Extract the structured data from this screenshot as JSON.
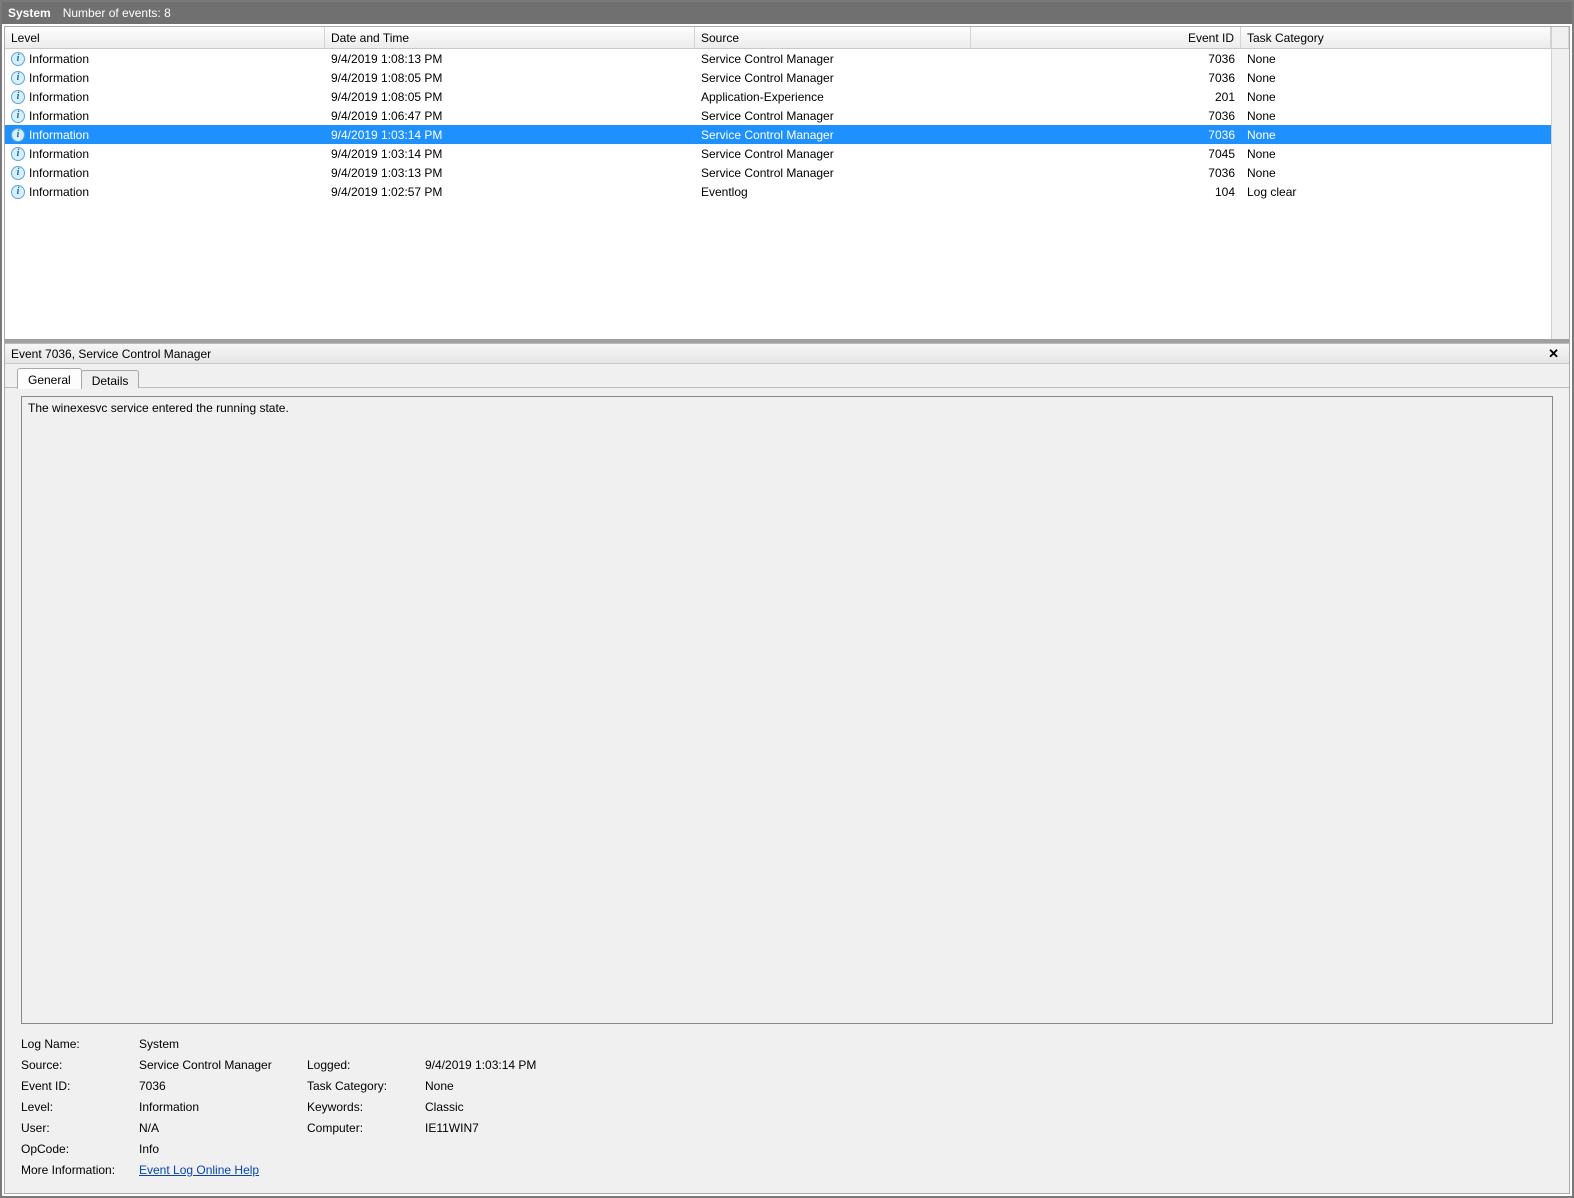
{
  "topbar": {
    "system_label": "System",
    "events_count_label": "Number of events: 8"
  },
  "columns": {
    "level": "Level",
    "date": "Date and Time",
    "source": "Source",
    "event_id": "Event ID",
    "task": "Task Category"
  },
  "events": [
    {
      "level": "Information",
      "date": "9/4/2019 1:08:13 PM",
      "source": "Service Control Manager",
      "event_id": "7036",
      "task": "None",
      "selected": false
    },
    {
      "level": "Information",
      "date": "9/4/2019 1:08:05 PM",
      "source": "Service Control Manager",
      "event_id": "7036",
      "task": "None",
      "selected": false
    },
    {
      "level": "Information",
      "date": "9/4/2019 1:08:05 PM",
      "source": "Application-Experience",
      "event_id": "201",
      "task": "None",
      "selected": false
    },
    {
      "level": "Information",
      "date": "9/4/2019 1:06:47 PM",
      "source": "Service Control Manager",
      "event_id": "7036",
      "task": "None",
      "selected": false
    },
    {
      "level": "Information",
      "date": "9/4/2019 1:03:14 PM",
      "source": "Service Control Manager",
      "event_id": "7036",
      "task": "None",
      "selected": true
    },
    {
      "level": "Information",
      "date": "9/4/2019 1:03:14 PM",
      "source": "Service Control Manager",
      "event_id": "7045",
      "task": "None",
      "selected": false
    },
    {
      "level": "Information",
      "date": "9/4/2019 1:03:13 PM",
      "source": "Service Control Manager",
      "event_id": "7036",
      "task": "None",
      "selected": false
    },
    {
      "level": "Information",
      "date": "9/4/2019 1:02:57 PM",
      "source": "Eventlog",
      "event_id": "104",
      "task": "Log clear",
      "selected": false
    }
  ],
  "details": {
    "header_title": "Event 7036, Service Control Manager",
    "tabs": {
      "general": "General",
      "details": "Details"
    },
    "active_tab": "general",
    "message": "The winexesvc service entered the running state.",
    "meta": {
      "labels": {
        "log_name": "Log Name:",
        "source": "Source:",
        "event_id": "Event ID:",
        "level": "Level:",
        "user": "User:",
        "opcode": "OpCode:",
        "more_info": "More Information:",
        "logged": "Logged:",
        "task_category": "Task Category:",
        "keywords": "Keywords:",
        "computer": "Computer:"
      },
      "values": {
        "log_name": "System",
        "source": "Service Control Manager",
        "event_id": "7036",
        "level": "Information",
        "user": "N/A",
        "opcode": "Info",
        "more_info_link": "Event Log Online Help",
        "logged": "9/4/2019 1:03:14 PM",
        "task_category": "None",
        "keywords": "Classic",
        "computer": "IE11WIN7"
      }
    }
  }
}
